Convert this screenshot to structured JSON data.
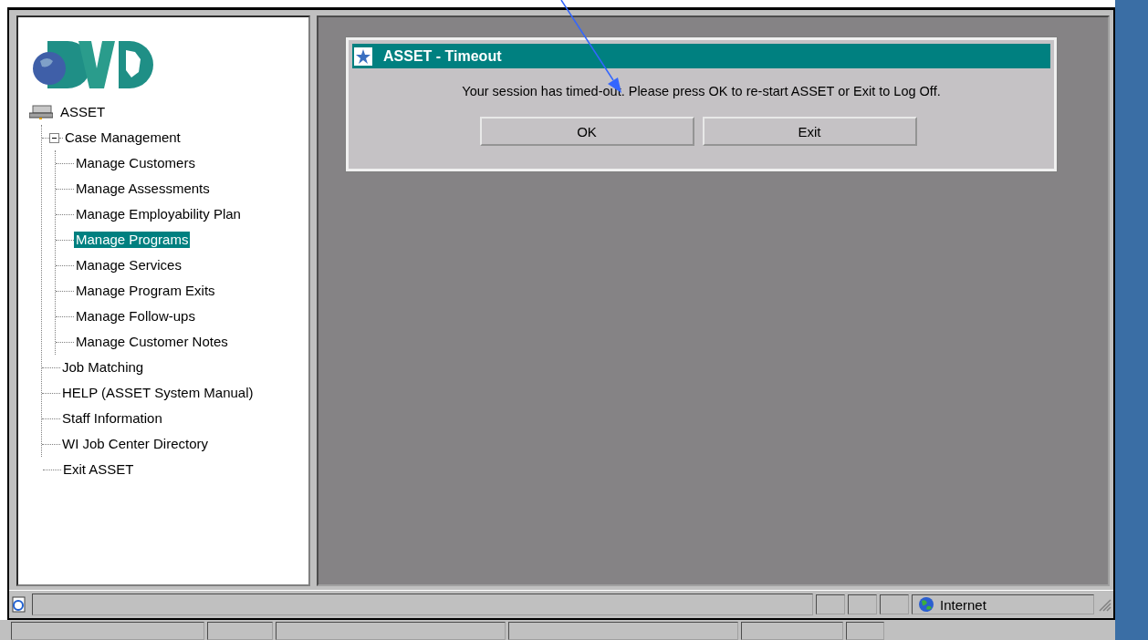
{
  "tree": {
    "label": "ASSET",
    "children": [
      {
        "label": "Case Management",
        "expanded": true,
        "selected": false,
        "children": [
          {
            "label": "Manage Customers",
            "selected": false
          },
          {
            "label": "Manage Assessments",
            "selected": false
          },
          {
            "label": "Manage Employability Plan",
            "selected": false
          },
          {
            "label": "Manage Programs",
            "selected": true
          },
          {
            "label": "Manage Services",
            "selected": false
          },
          {
            "label": "Manage Program Exits",
            "selected": false
          },
          {
            "label": "Manage Follow-ups",
            "selected": false
          },
          {
            "label": "Manage Customer Notes",
            "selected": false
          }
        ]
      },
      {
        "label": "Job Matching",
        "selected": false
      },
      {
        "label": "HELP (ASSET System Manual)",
        "selected": false
      },
      {
        "label": "Staff Information",
        "selected": false
      },
      {
        "label": "WI Job Center Directory",
        "selected": false
      },
      {
        "label": "Exit ASSET",
        "selected": false
      }
    ]
  },
  "dialog": {
    "title": "ASSET - Timeout",
    "message": "Your session has timed-out. Please press OK to re-start ASSET or Exit to Log Off.",
    "buttons": [
      "OK",
      "Exit"
    ]
  },
  "status_bar": {
    "zone": "Internet"
  }
}
